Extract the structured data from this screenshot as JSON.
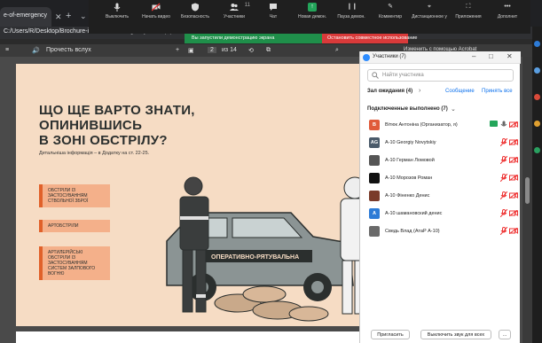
{
  "browser": {
    "tab_title": "e-of-emergency",
    "address": "C:/Users/R/Desktop/Brochure-in-case of emergency w. map.pdf"
  },
  "zoom_toolbar": {
    "items": [
      {
        "label": "Выключить",
        "icon": "microphone-icon"
      },
      {
        "label": "Начать видео",
        "icon": "video-off-icon"
      },
      {
        "label": "Безопасность",
        "icon": "shield-icon"
      },
      {
        "label": "Участники",
        "icon": "participants-icon",
        "count": "11"
      },
      {
        "label": "Чат",
        "icon": "chat-icon"
      },
      {
        "label": "Новая демон.",
        "icon": "share-screen-icon"
      },
      {
        "label": "Пауза демон.",
        "icon": "pause-icon"
      },
      {
        "label": "Комментир",
        "icon": "annotate-icon"
      },
      {
        "label": "Дистанционное у",
        "icon": "remote-control-icon"
      },
      {
        "label": "Приложения",
        "icon": "apps-icon"
      },
      {
        "label": "Дополнит",
        "icon": "more-icon"
      }
    ]
  },
  "share_notice": {
    "sharing": "Вы запустили демонстрацию экрана",
    "stop": "Остановить совместное использование"
  },
  "pdf_toolbar": {
    "read_aloud": "Прочесть вслух",
    "page_current": "2",
    "page_total": "из 14",
    "edit_hint": "Изменить с помощью Acrobat"
  },
  "document": {
    "title": "ЩО ЩЕ ВАРТО ЗНАТИ,\nОПИНИВШИСЬ\nВ ЗОНІ ОБСТРІЛУ?",
    "subtitle": "Детальніша інформація – в Додатку на ст. 22-25.",
    "boxes": [
      "Обстріли із застосуванням ствольної зброї",
      "Артобстріли",
      "Артилерійські обстріли із застосуванням систем залпового вогню"
    ],
    "vehicle_label": "ОПЕРАТИВНО-РЯТУВАЛЬНА"
  },
  "participants_panel": {
    "title": "Участники (7)",
    "search_placeholder": "Найти участника",
    "waiting_label": "Зал ожидания (4)",
    "waiting_message": "Сообщение",
    "waiting_accept": "Принять все",
    "connected_label": "Подключенные выполнено (7)",
    "participants": [
      {
        "name": "Вітюк Антоніна (Организатор, я)",
        "initials": "В",
        "color": "#e05a3a"
      },
      {
        "name": "А-10 Georgiy Novytskiy",
        "initials": "AG",
        "color": "#4a5a6a"
      },
      {
        "name": "А-10 Герман Ломовой",
        "initials": "",
        "color": "#555555"
      },
      {
        "name": "А-10 Морозов Роман",
        "initials": "",
        "color": "#111111"
      },
      {
        "name": "А-10 Фіненко Денис",
        "initials": "",
        "color": "#7a3b2a"
      },
      {
        "name": "А-10 шамановский денис",
        "initials": "А",
        "color": "#2d7bd6"
      },
      {
        "name": "Сведь Влад (АтаР А-10)",
        "initials": "",
        "color": "#6a6a6a"
      }
    ],
    "invite_button": "Пригласить",
    "mute_all_button": "Выключить звук для всех",
    "more_button": "..."
  }
}
